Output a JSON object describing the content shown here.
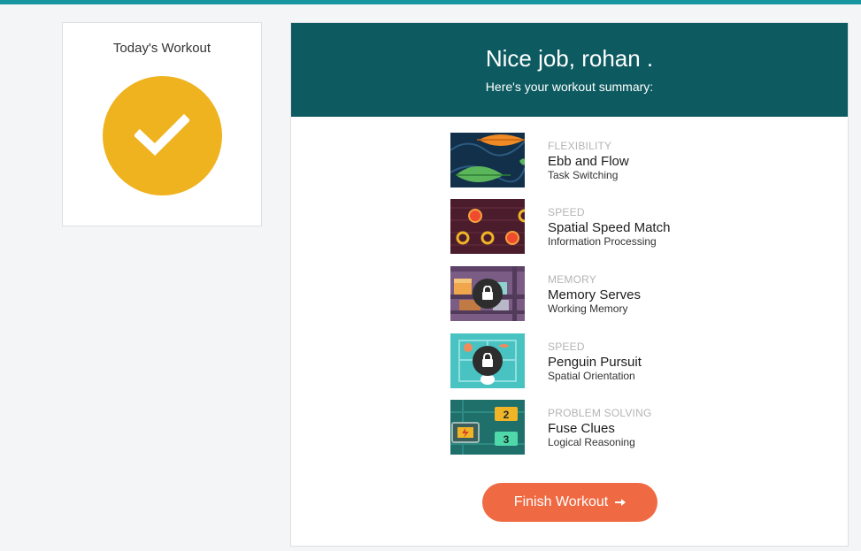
{
  "colors": {
    "topbar": "#16969f",
    "header_bg": "#0d5b61",
    "check_circle": "#efb320",
    "finish_button": "#ef6a42"
  },
  "today": {
    "title": "Today's Workout",
    "status_icon": "checkmark-icon"
  },
  "summary": {
    "greeting": "Nice job, rohan .",
    "subtitle": "Here's your workout summary:"
  },
  "games": [
    {
      "category": "FLEXIBILITY",
      "name": "Ebb and Flow",
      "skill": "Task Switching",
      "locked": false,
      "thumb_icon": "leaves-icon"
    },
    {
      "category": "SPEED",
      "name": "Spatial Speed Match",
      "skill": "Information Processing",
      "locked": false,
      "thumb_icon": "circles-icon"
    },
    {
      "category": "MEMORY",
      "name": "Memory Serves",
      "skill": "Working Memory",
      "locked": true,
      "thumb_icon": "shelf-icon"
    },
    {
      "category": "SPEED",
      "name": "Penguin Pursuit",
      "skill": "Spatial Orientation",
      "locked": true,
      "thumb_icon": "penguin-icon"
    },
    {
      "category": "PROBLEM SOLVING",
      "name": "Fuse Clues",
      "skill": "Logical Reasoning",
      "locked": false,
      "thumb_icon": "fuse-icon",
      "thumb_text": [
        "2",
        "3"
      ]
    }
  ],
  "finish_button": {
    "label": "Finish Workout",
    "icon": "arrow-right-icon"
  }
}
